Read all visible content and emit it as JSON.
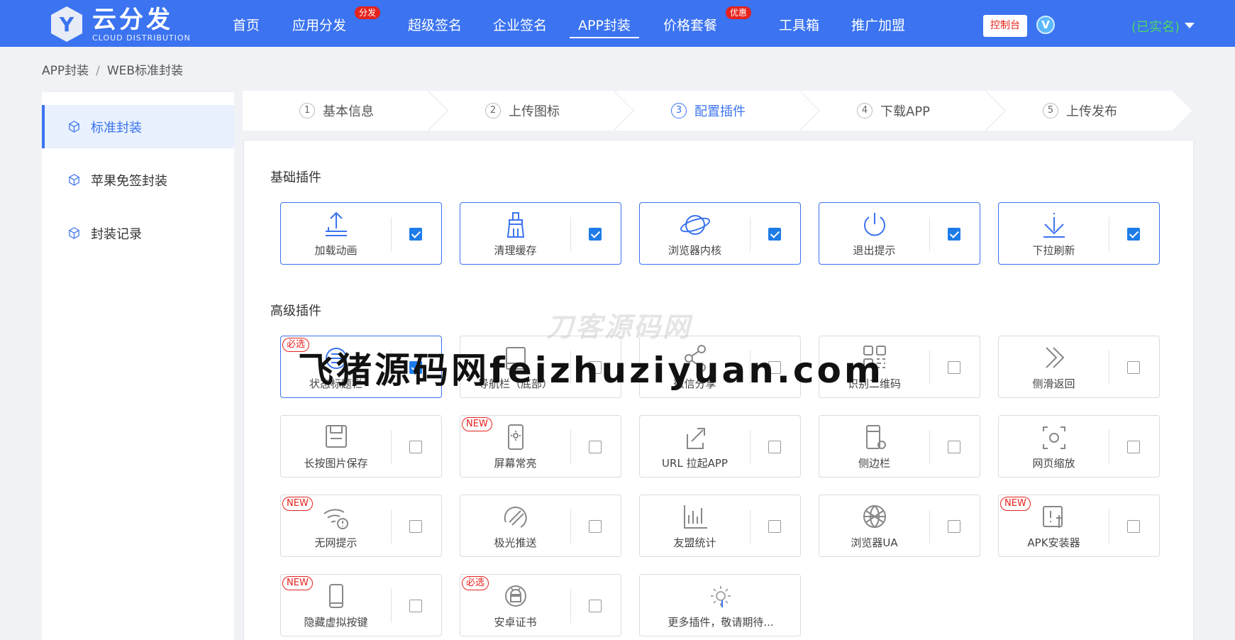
{
  "header": {
    "logo_letter": "Y",
    "logo_main": "云分发",
    "logo_sub": "CLOUD DISTRIBUTION",
    "nav": [
      {
        "label": "首页",
        "badge": ""
      },
      {
        "label": "应用分发",
        "badge": "分发"
      },
      {
        "label": "超级签名",
        "badge": ""
      },
      {
        "label": "企业签名",
        "badge": ""
      },
      {
        "label": "APP封装",
        "badge": "",
        "active": true
      },
      {
        "label": "价格套餐",
        "badge": "优惠"
      },
      {
        "label": "工具箱",
        "badge": ""
      },
      {
        "label": "推广加盟",
        "badge": ""
      }
    ],
    "console_label": "控制台",
    "vip_letter": "V",
    "user_status": "(已实名)"
  },
  "breadcrumb": {
    "root": "APP封装",
    "separator": "/",
    "current": "WEB标准封装"
  },
  "sidebar": {
    "items": [
      {
        "label": "标准封装",
        "active": true
      },
      {
        "label": "苹果免签封装"
      },
      {
        "label": "封装记录"
      }
    ]
  },
  "steps": [
    {
      "num": "1",
      "label": "基本信息"
    },
    {
      "num": "2",
      "label": "上传图标"
    },
    {
      "num": "3",
      "label": "配置插件",
      "active": true
    },
    {
      "num": "4",
      "label": "下载APP"
    },
    {
      "num": "5",
      "label": "上传发布"
    }
  ],
  "basic_section": {
    "title": "基础插件",
    "plugins": [
      {
        "label": "加载动画",
        "icon": "upload-icon",
        "checked": true
      },
      {
        "label": "清理缓存",
        "icon": "broom-icon",
        "checked": true
      },
      {
        "label": "浏览器内核",
        "icon": "planet-icon",
        "checked": true
      },
      {
        "label": "退出提示",
        "icon": "power-icon",
        "checked": true
      },
      {
        "label": "下拉刷新",
        "icon": "pull-down-icon",
        "checked": true
      }
    ]
  },
  "advanced_section": {
    "title": "高级插件",
    "plugins": [
      {
        "label": "状态标题栏",
        "icon": "status-bar-icon",
        "checked": true,
        "tag": "必选"
      },
      {
        "label": "导航栏（底部）",
        "icon": "nav-bar-icon",
        "checked": false,
        "tag": ""
      },
      {
        "label": "微信分享",
        "icon": "share-icon",
        "checked": false,
        "tag": ""
      },
      {
        "label": "识别二维码",
        "icon": "qrcode-icon",
        "checked": false,
        "tag": ""
      },
      {
        "label": "侧滑返回",
        "icon": "double-chevron-icon",
        "checked": false,
        "tag": ""
      },
      {
        "label": "长按图片保存",
        "icon": "save-icon",
        "checked": false,
        "tag": ""
      },
      {
        "label": "屏幕常亮",
        "icon": "phone-brightness-icon",
        "checked": false,
        "tag": "NEW"
      },
      {
        "label": "URL 拉起APP",
        "icon": "open-external-icon",
        "checked": false,
        "tag": ""
      },
      {
        "label": "侧边栏",
        "icon": "sidebar-panel-icon",
        "checked": false,
        "tag": ""
      },
      {
        "label": "网页缩放",
        "icon": "zoom-frame-icon",
        "checked": false,
        "tag": ""
      },
      {
        "label": "无网提示",
        "icon": "wifi-alert-icon",
        "checked": false,
        "tag": "NEW"
      },
      {
        "label": "极光推送",
        "icon": "push-icon",
        "checked": false,
        "tag": ""
      },
      {
        "label": "友盟统计",
        "icon": "bar-chart-icon",
        "checked": false,
        "tag": ""
      },
      {
        "label": "浏览器UA",
        "icon": "globe-icon",
        "checked": false,
        "tag": ""
      },
      {
        "label": "APK安装器",
        "icon": "apk-installer-icon",
        "checked": false,
        "tag": "NEW"
      },
      {
        "label": "隐藏虚拟按键",
        "icon": "phone-icon",
        "checked": false,
        "tag": "NEW"
      },
      {
        "label": "安卓证书",
        "icon": "android-icon",
        "checked": false,
        "tag": "必选"
      }
    ],
    "more_label": "更多插件，敬请期待..."
  },
  "watermarks": {
    "faint": "刀客源码网",
    "main": "飞猪源码网feizhuziyuan.com"
  },
  "colors": {
    "primary": "#3b73f0",
    "checkbox": "#1e7ce8",
    "badge_red": "#e6231d",
    "verified_green": "#4cd964"
  }
}
